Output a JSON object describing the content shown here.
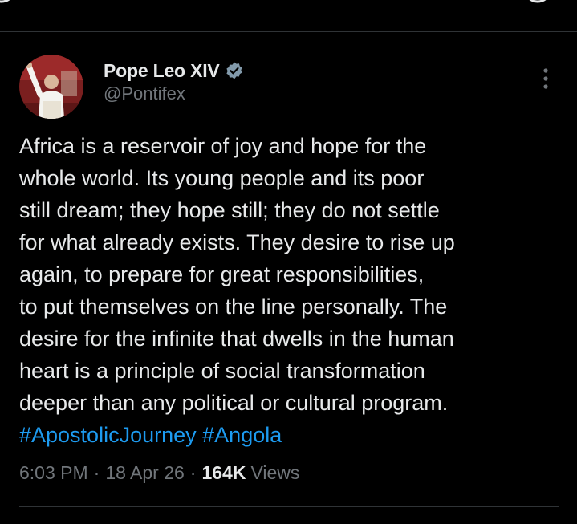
{
  "tweet": {
    "author": {
      "display_name": "Pope Leo XIV",
      "handle": "@Pontifex",
      "verified": true,
      "verified_color": "#829aab",
      "avatar_icon": "avatar-photo"
    },
    "text": "Africa is a reservoir of joy and hope for the\nwhole world. Its young people and its poor\nstill dream; they hope still; they do not settle\nfor what already exists. They desire to rise up\nagain, to prepare for great responsibilities,\nto put themselves on the line personally. The\ndesire for the infinite that dwells in the human\nheart is a principle of social transformation\ndeeper than any political or cultural program.",
    "hashtags": [
      "#ApostolicJourney",
      "#Angola"
    ],
    "time": "6:03 PM",
    "date": "18 Apr 26",
    "separator": "·",
    "views_count": "164K",
    "views_label": "Views"
  },
  "colors": {
    "background": "#000000",
    "text": "#e7e9ea",
    "secondary_text": "#71767b",
    "link": "#1d9bf0",
    "divider": "#2f3336"
  },
  "icons": {
    "more": "more-vertical-icon",
    "verified": "verified-badge-icon"
  }
}
